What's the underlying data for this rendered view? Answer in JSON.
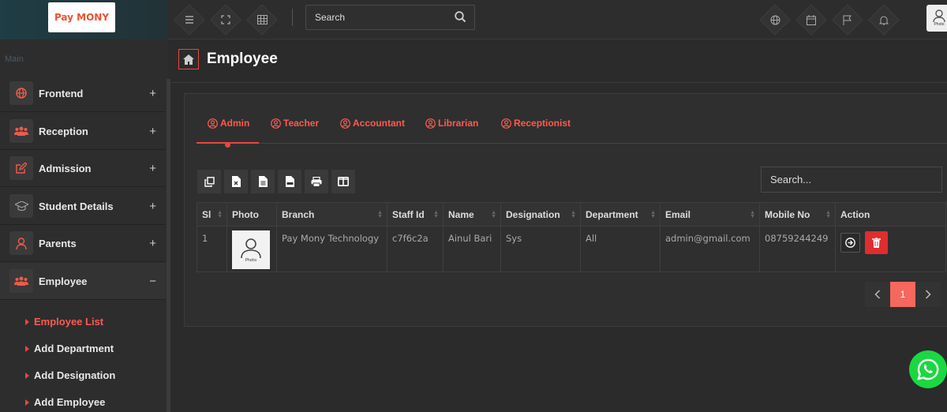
{
  "app": {
    "logo_text": "Pay MONY"
  },
  "topbar": {
    "search_placeholder": "Search",
    "avatar_label": "Photo"
  },
  "sidebar": {
    "section_label": "Main",
    "items": [
      {
        "label": "Frontend",
        "toggle": "+",
        "icon": "globe-icon"
      },
      {
        "label": "Reception",
        "toggle": "+",
        "icon": "users-icon"
      },
      {
        "label": "Admission",
        "toggle": "+",
        "icon": "edit-icon"
      },
      {
        "label": "Student Details",
        "toggle": "+",
        "icon": "graduation-cap-icon"
      },
      {
        "label": "Parents",
        "toggle": "+",
        "icon": "user-icon"
      },
      {
        "label": "Employee",
        "toggle": "−",
        "icon": "users-icon"
      }
    ],
    "subitems": [
      "Employee List",
      "Add Department",
      "Add Designation",
      "Add Employee"
    ]
  },
  "page": {
    "title": "Employee"
  },
  "tabs": [
    "Admin",
    "Teacher",
    "Accountant",
    "Librarian",
    "Receptionist"
  ],
  "table": {
    "search_placeholder": "Search...",
    "columns": [
      "Sl",
      "Photo",
      "Branch",
      "Staff Id",
      "Name",
      "Designation",
      "Department",
      "Email",
      "Mobile No",
      "Action"
    ],
    "rows": [
      {
        "sl": "1",
        "photo_label": "Photo",
        "branch": "Pay Mony Technology",
        "staff_id": "c7f6c2a",
        "name": "Ainul Bari",
        "designation": "Sys",
        "department": "All",
        "email": "admin@gmail.com",
        "mobile": "08759244249"
      }
    ]
  },
  "pagination": {
    "current": "1"
  },
  "colors": {
    "accent": "#e8473f",
    "whatsapp": "#1bd741",
    "delete": "#e02d2d"
  }
}
